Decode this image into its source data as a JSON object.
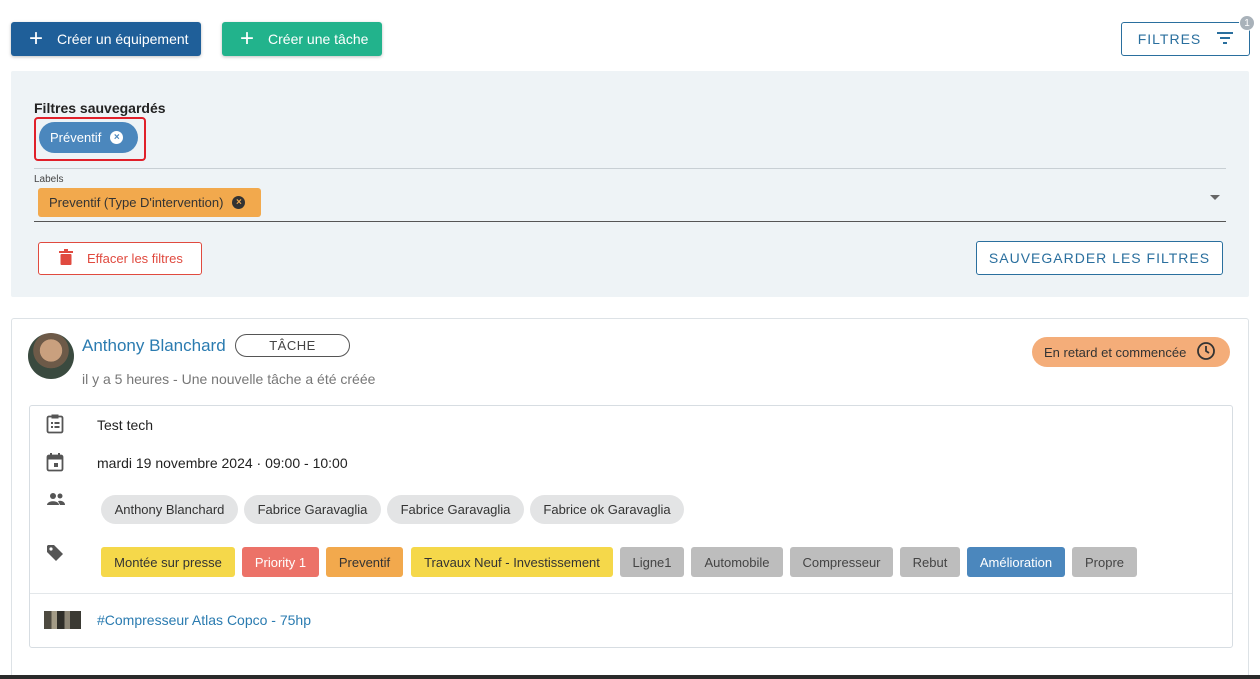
{
  "toolbar": {
    "create_equipment_label": "Créer un équipement",
    "create_task_label": "Créer une tâche",
    "filters_label": "FILTRES",
    "filters_badge": "1",
    "plus_icon": "+",
    "colors": {
      "primary": "#1f5f99",
      "teal": "#22b38c",
      "outline": "#2a6f9e"
    }
  },
  "filter_panel": {
    "saved_title": "Filtres sauvegardés",
    "saved_chip_label": "Préventif",
    "labels_caption": "Labels",
    "selected_label": "Preventif (Type D'intervention)",
    "clear_button": "Effacer les filtres",
    "save_button": "SAUVEGARDER LES FILTRES",
    "chip_remove_icon": "×"
  },
  "card": {
    "author": "Anthony Blanchard",
    "type_chip": "TÂCHE",
    "subtitle": "il y a 5 heures - Une nouvelle tâche a été créée",
    "status": "En retard et commencée",
    "task_title": "Test tech",
    "date": "mardi 19 novembre 2024 · 09:00 - 10:00",
    "people": [
      "Anthony Blanchard",
      "Fabrice Garavaglia",
      "Fabrice Garavaglia",
      "Fabrice ok Garavaglia"
    ],
    "tags": [
      {
        "label": "Montée sur presse",
        "color": "#f5d84a"
      },
      {
        "label": "Priority 1",
        "color": "#ec7268"
      },
      {
        "label": "Preventif",
        "color": "#f2a94d"
      },
      {
        "label": "Travaux Neuf - Investissement",
        "color": "#f5d84a"
      },
      {
        "label": "Ligne1",
        "color": "#bdbdbd"
      },
      {
        "label": "Automobile",
        "color": "#bdbdbd"
      },
      {
        "label": "Compresseur",
        "color": "#bdbdbd"
      },
      {
        "label": "Rebut",
        "color": "#bdbdbd"
      },
      {
        "label": "Amélioration",
        "color": "#4b87bd"
      },
      {
        "label": "Propre",
        "color": "#bdbdbd"
      }
    ],
    "equipment_link": "#Compresseur Atlas Copco - 75hp"
  }
}
